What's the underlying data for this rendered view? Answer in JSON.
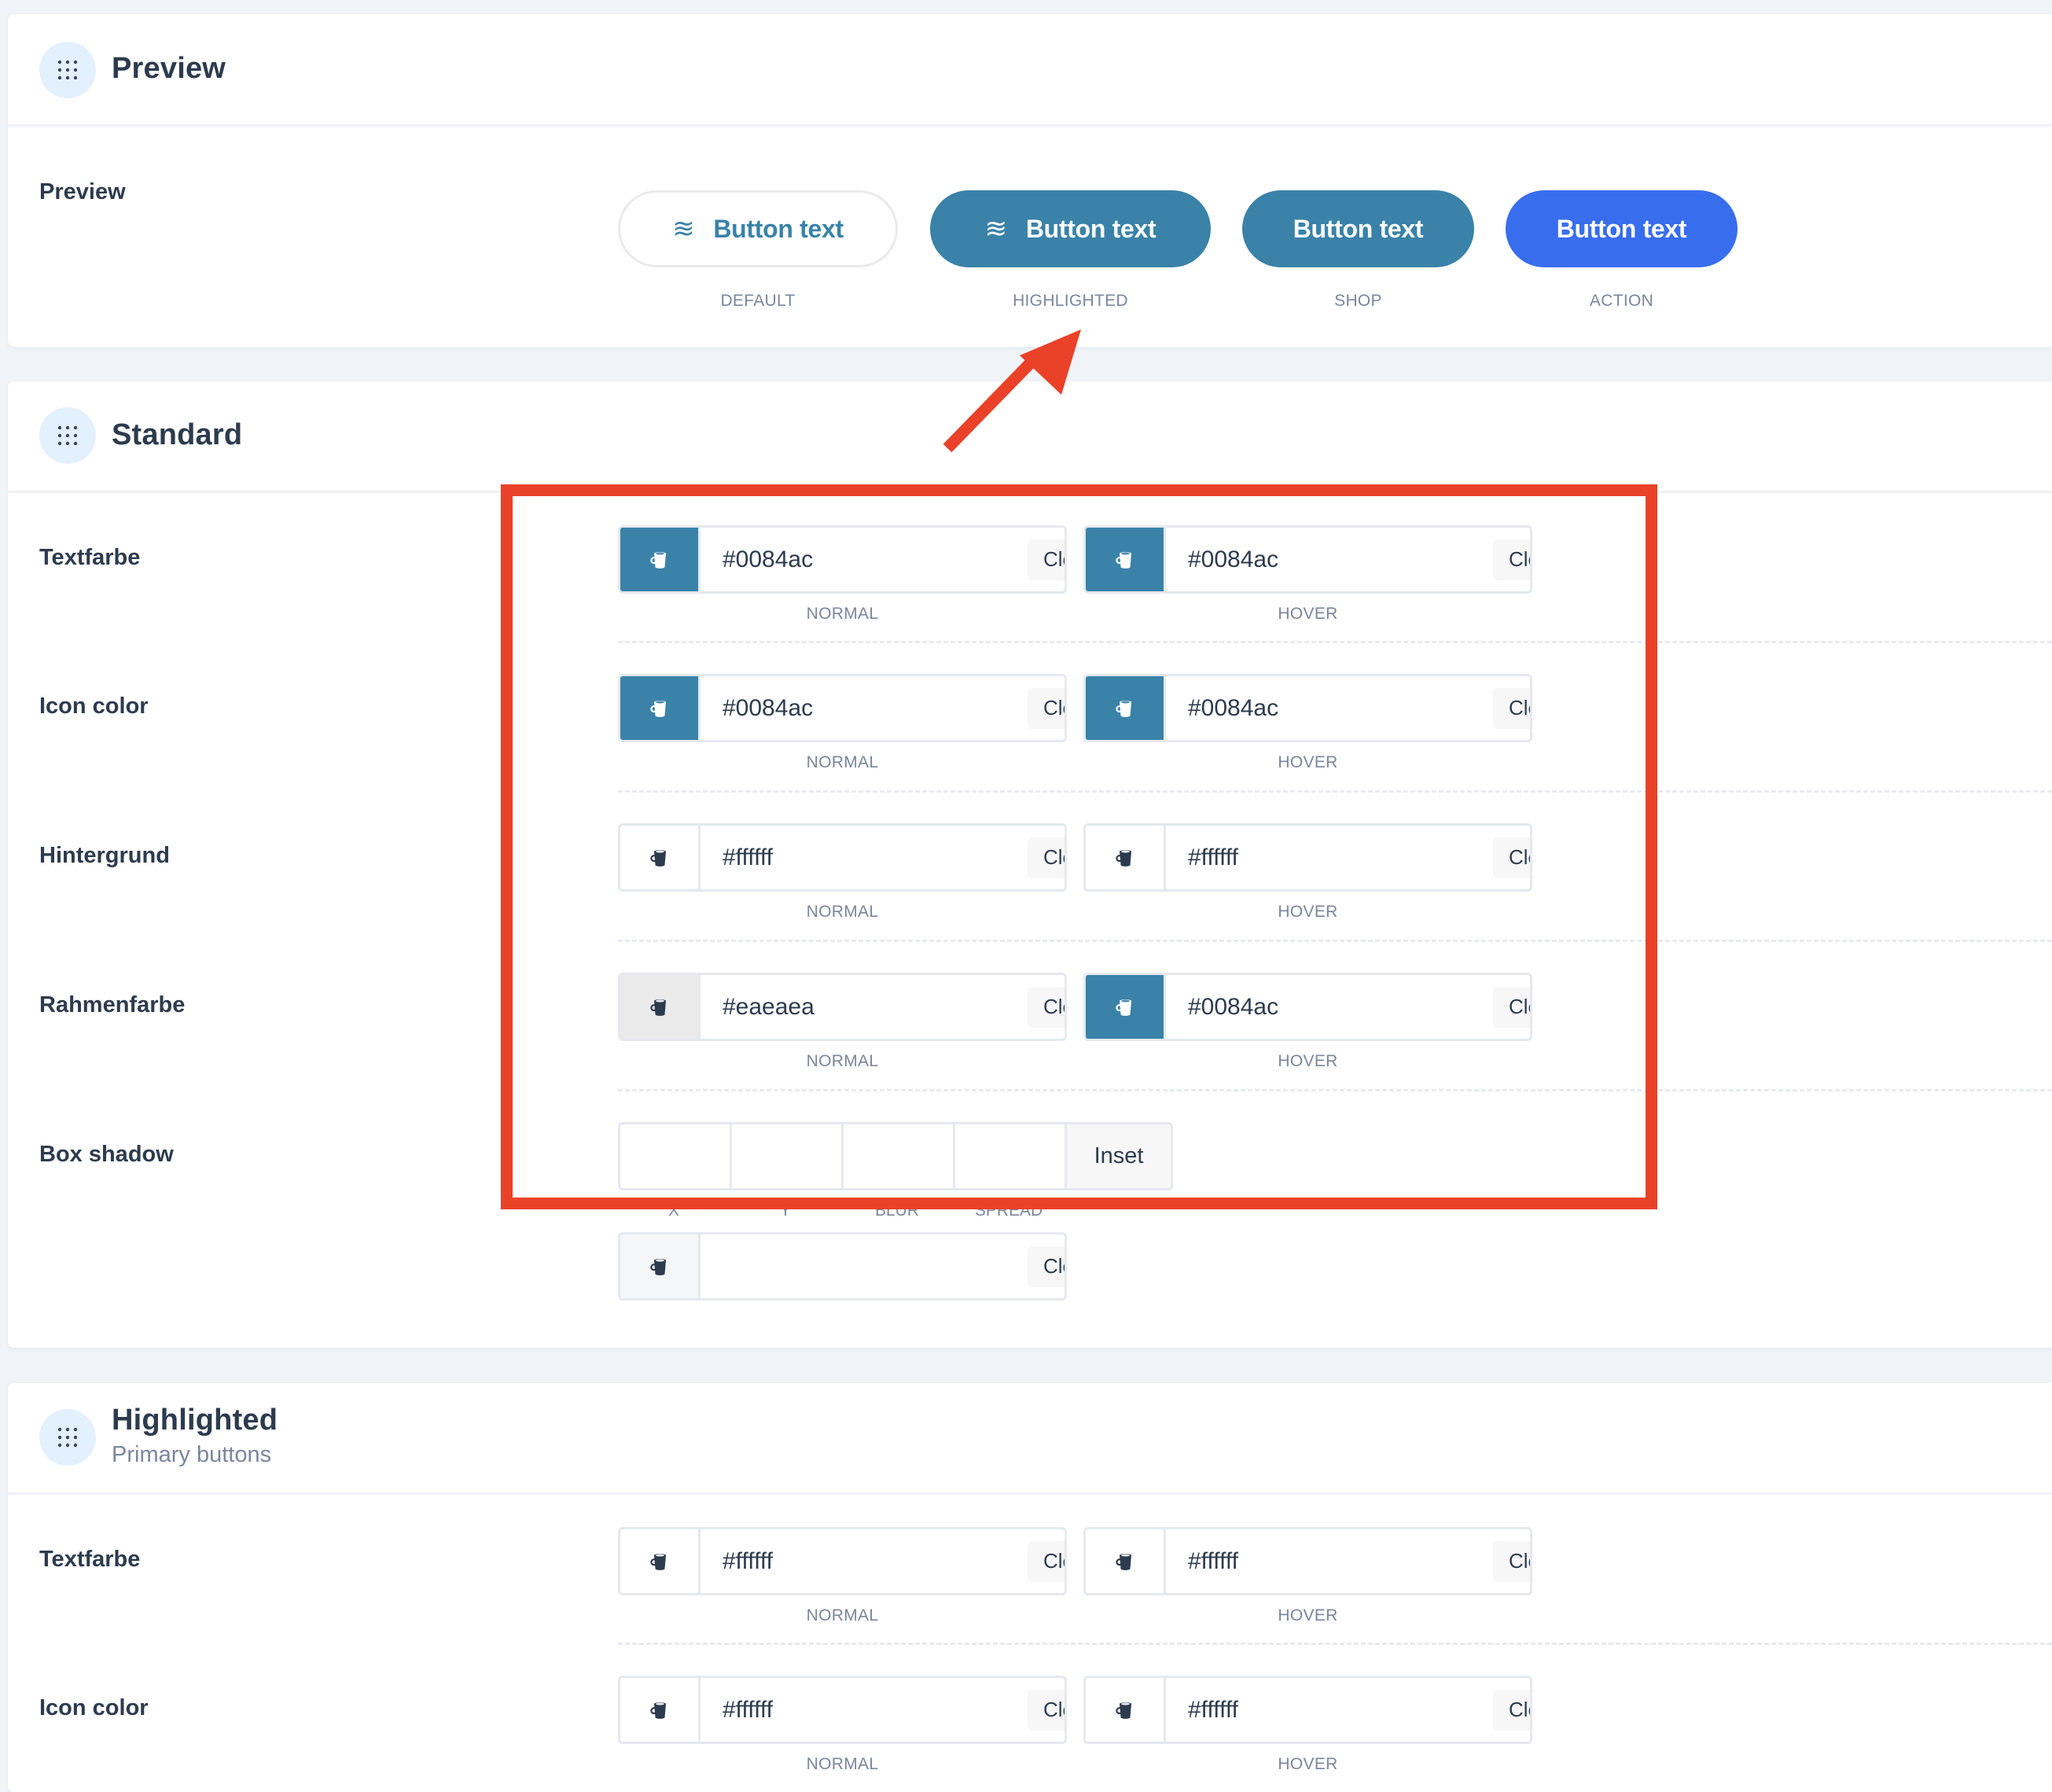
{
  "colors": {
    "brand": "#0084ac",
    "swatch_teal": "#3a82a8",
    "action_blue": "#386ded",
    "annotation_red": "#ea4129"
  },
  "preview_section": {
    "title": "Preview",
    "row_label": "Preview",
    "buttons": [
      {
        "label": "Button text",
        "caption": "DEFAULT",
        "icon": "waves-icon",
        "icon_glyph": "≋"
      },
      {
        "label": "Button text",
        "caption": "HIGHLIGHTED",
        "icon": "waves-icon",
        "icon_glyph": "≋"
      },
      {
        "label": "Button text",
        "caption": "SHOP"
      },
      {
        "label": "Button text",
        "caption": "ACTION"
      }
    ]
  },
  "standard_section": {
    "title": "Standard",
    "rows": [
      {
        "label": "Textfarbe",
        "normal": {
          "value": "#0084ac",
          "caption": "NORMAL",
          "clear": "Clear"
        },
        "hover": {
          "value": "#0084ac",
          "caption": "HOVER",
          "clear": "Clear"
        }
      },
      {
        "label": "Icon color",
        "normal": {
          "value": "#0084ac",
          "caption": "NORMAL",
          "clear": "Clear"
        },
        "hover": {
          "value": "#0084ac",
          "caption": "HOVER",
          "clear": "Clear"
        }
      },
      {
        "label": "Hintergrund",
        "normal": {
          "value": "#ffffff",
          "caption": "NORMAL",
          "clear": "Clear"
        },
        "hover": {
          "value": "#ffffff",
          "caption": "HOVER",
          "clear": "Clear"
        }
      },
      {
        "label": "Rahmenfarbe",
        "normal": {
          "value": "#eaeaea",
          "caption": "NORMAL",
          "clear": "Clear"
        },
        "hover": {
          "value": "#0084ac",
          "caption": "HOVER",
          "clear": "Clear"
        }
      }
    ],
    "box_shadow": {
      "label": "Box shadow",
      "fields": [
        {
          "caption": "X",
          "value": ""
        },
        {
          "caption": "Y",
          "value": ""
        },
        {
          "caption": "BLUR",
          "value": ""
        },
        {
          "caption": "SPREAD",
          "value": ""
        }
      ],
      "inset_label": "Inset",
      "color": {
        "value": "",
        "clear": "Clear"
      }
    }
  },
  "highlighted_section": {
    "title": "Highlighted",
    "subtitle": "Primary buttons",
    "rows": [
      {
        "label": "Textfarbe",
        "normal": {
          "value": "#ffffff",
          "caption": "NORMAL",
          "clear": "Clear"
        },
        "hover": {
          "value": "#ffffff",
          "caption": "HOVER",
          "clear": "Clear"
        }
      },
      {
        "label": "Icon color",
        "normal": {
          "value": "#ffffff",
          "caption": "NORMAL",
          "clear": "Clear"
        },
        "hover": {
          "value": "#ffffff",
          "caption": "HOVER",
          "clear": "Clear"
        }
      }
    ]
  }
}
